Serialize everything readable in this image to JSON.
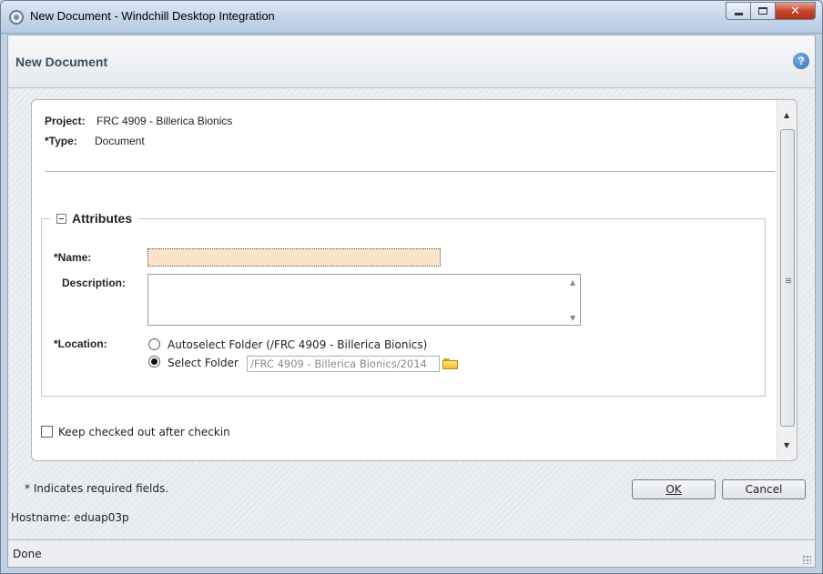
{
  "window": {
    "title": "New Document - Windchill Desktop Integration",
    "controls": {
      "minimize": "minimize",
      "maximize": "maximize",
      "close": "close"
    }
  },
  "dialog": {
    "title": "New Document",
    "help_icon": "?"
  },
  "info": {
    "project_label": "Project:",
    "project_value": "FRC 4909 - Billerica Bionics",
    "type_label": "*Type:",
    "type_value": "Document"
  },
  "attributes": {
    "legend": "Attributes",
    "name_label": "*Name:",
    "name_value": "",
    "description_label": "Description:",
    "description_value": "",
    "location_label": "*Location:",
    "location_options": [
      {
        "label": "Autoselect Folder (/FRC 4909 - Billerica Bionics)",
        "selected": false
      },
      {
        "label": "Select Folder",
        "selected": true
      }
    ],
    "folder_path": "/FRC 4909 - Billerica Bionics/2014"
  },
  "keep_checked_out": {
    "label": "Keep checked out after checkin",
    "checked": false
  },
  "footer": {
    "required_note": "* Indicates required fields.",
    "hostname": "Hostname: eduap03p",
    "ok_label": "OK",
    "cancel_label": "Cancel"
  },
  "status": {
    "text": "Done"
  },
  "colors": {
    "name_field_bg": "#fbe3c8",
    "dialog_title": "#3b4e63",
    "close_button": "#c8452c"
  }
}
